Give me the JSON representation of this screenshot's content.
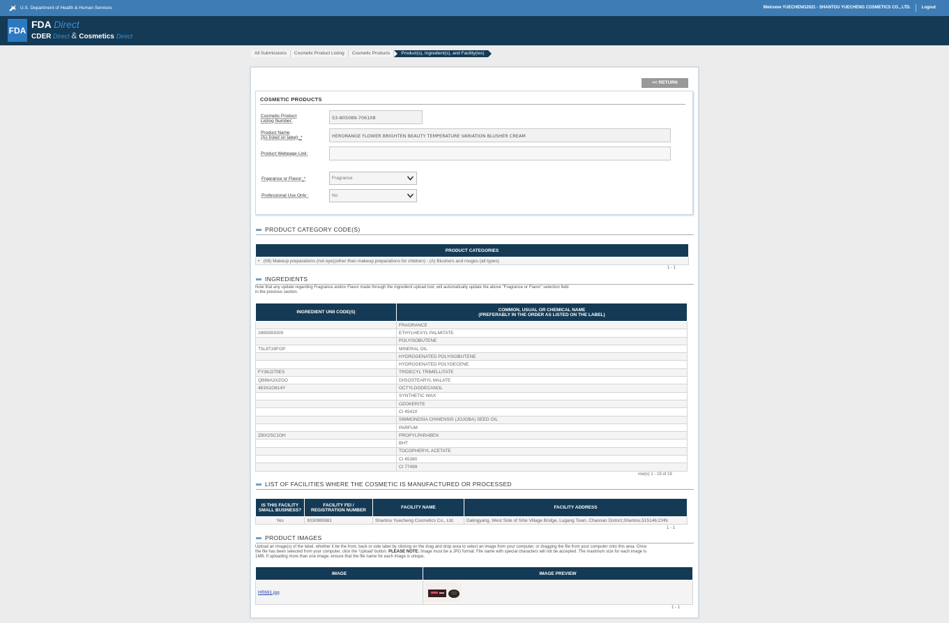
{
  "topbar": {
    "agency": "U.S. Department of Health & Human Services",
    "welcome": "Welcome YUECHENG2021 - SHANTOU YUECHENG COSMETICS CO., LTD.",
    "logout": "Logout"
  },
  "header": {
    "badge": "FDA",
    "brand_fda": "FDA",
    "brand_direct": "Direct",
    "cder": "CDER",
    "cder_direct": "Direct",
    "amp": "&",
    "cosmetics": "Cosmetics",
    "cosmetics_direct": "Direct"
  },
  "breadcrumbs": [
    "All Submissions",
    "Cosmetic Product Listing",
    "Cosmetic Products",
    "Product(s), Ingredient(s), and Facility(ies)"
  ],
  "return_label": "<< RETURN",
  "products": {
    "title": "COSMETIC PRODUCTS",
    "listing_label_1": "Cosmetic Product",
    "listing_label_2": "Listing Number:",
    "listing_value": "S3-805089-706108",
    "name_label_1": "Product Name",
    "name_label_2": "(As listed on label):",
    "name_value": "HERORANGE FLOWER BRIGHTEN BEAUTY TEMPERATURE VARIATION BLUSHER CREAM",
    "webpage_label": "Product Webpage Link:",
    "webpage_value": "",
    "fragrance_label": "Fragrance or Flavor:",
    "fragrance_value": "Fragrance",
    "professional_label": "Professional Use Only :",
    "professional_value": "No",
    "required_mark": "*"
  },
  "category": {
    "header": "PRODUCT CATEGORY CODE(S)",
    "column": "PRODUCT CATEGORIES",
    "rows": [
      "(08) Makeup preparations (not eye)(other than makeup preparations for children) - (A) Blushers and rouges (all types)"
    ],
    "pager": "1 - 1"
  },
  "ingredients": {
    "header": "INGREDIENTS",
    "note_1": "Note that any update regarding Fragrance and/or Flavor made through the ingredient upload tool, will automatically update the above \"Fragrance or Flavor\" selection field",
    "note_2": "in the previous section.",
    "col_unii": "INGREDIENT UNII CODE(S)",
    "col_name_1": "COMMON, USUAL OR CHEMICAL NAME",
    "col_name_2": "(PREFERABLY IN THE ORDER AS LISTED ON THE LABEL)",
    "rows": [
      {
        "unii": "",
        "name": "FRAGRANCE"
      },
      {
        "unii": "2865993309",
        "name": "ETHYLHEXYL PALMITATE"
      },
      {
        "unii": "",
        "name": "POLYISOBUTENE"
      },
      {
        "unii": "T5L8T28FGP",
        "name": "MINERAL OIL"
      },
      {
        "unii": "",
        "name": "HYDROGENATED POLYISOBUTENE"
      },
      {
        "unii": "",
        "name": "HYDROGENATED POLYDECENE"
      },
      {
        "unii": "FY36J270ES",
        "name": "TRIDECYL TRIMELLITATE"
      },
      {
        "unii": "QB88A3XZGO",
        "name": "DIISOSTEARYL MALATE"
      },
      {
        "unii": "461N1O614Y",
        "name": "OCTYLDODECANOL"
      },
      {
        "unii": "",
        "name": "SYNTHETIC WAX"
      },
      {
        "unii": "",
        "name": "OZOKERITE"
      },
      {
        "unii": "",
        "name": "CI 45410"
      },
      {
        "unii": "",
        "name": "SIMMONDSIA CHINENSIS (JOJOBA) SEED OIL"
      },
      {
        "unii": "",
        "name": "PARFUM"
      },
      {
        "unii": "Z8IX2SC1OH",
        "name": "PROPYLPARABEN"
      },
      {
        "unii": "",
        "name": "BHT"
      },
      {
        "unii": "",
        "name": "TOCOPHERYL ACETATE"
      },
      {
        "unii": "",
        "name": "CI 45380"
      },
      {
        "unii": "",
        "name": "CI 77499"
      }
    ],
    "pager": "row(s) 1 - 19 of 19"
  },
  "facilities": {
    "header": "LIST OF FACILITIES WHERE THE COSMETIC IS MANUFACTURED OR PROCESSED",
    "col_small_1": "IS THIS FACILITY",
    "col_small_2": "SMALL BUSINESS?",
    "col_fei_1": "FACILITY FEI /",
    "col_fei_2": "REGISTRATION NUMBER",
    "col_name": "FACILITY NAME",
    "col_address": "FACILITY ADDRESS",
    "rows": [
      {
        "small": "Yes",
        "fei": "3030985981",
        "name": "Shantou Yuecheng Cosmetics Co., Ltd.",
        "address": "Dalingyang, West Side of Sihe Village Bridge, Lugang Town, Chaonan District,Shantou,515146,CHN"
      }
    ],
    "pager": "1 - 1"
  },
  "images": {
    "header": "PRODUCT IMAGES",
    "note_1": "Upload an image(s) of the label, whether it be the front, back or side label by clicking on the drag and drop area to select an image from your computer, or dragging the file from your computer onto this area. Once",
    "note_2a": "the file has been selected from your computer, click the 'Upload' button.",
    "note_2b": "PLEASE NOTE:",
    "note_2c": "Image must be a JPG format. File name with special characters will not be accepted. The maximum size for each image is",
    "note_3": "1MB. If uploading more than one image, ensure that the file name for each image is unique.",
    "col_image": "IMAGE",
    "col_preview": "IMAGE PREVIEW",
    "file_name": "HR691.jpg",
    "pager": "1 - 1"
  }
}
